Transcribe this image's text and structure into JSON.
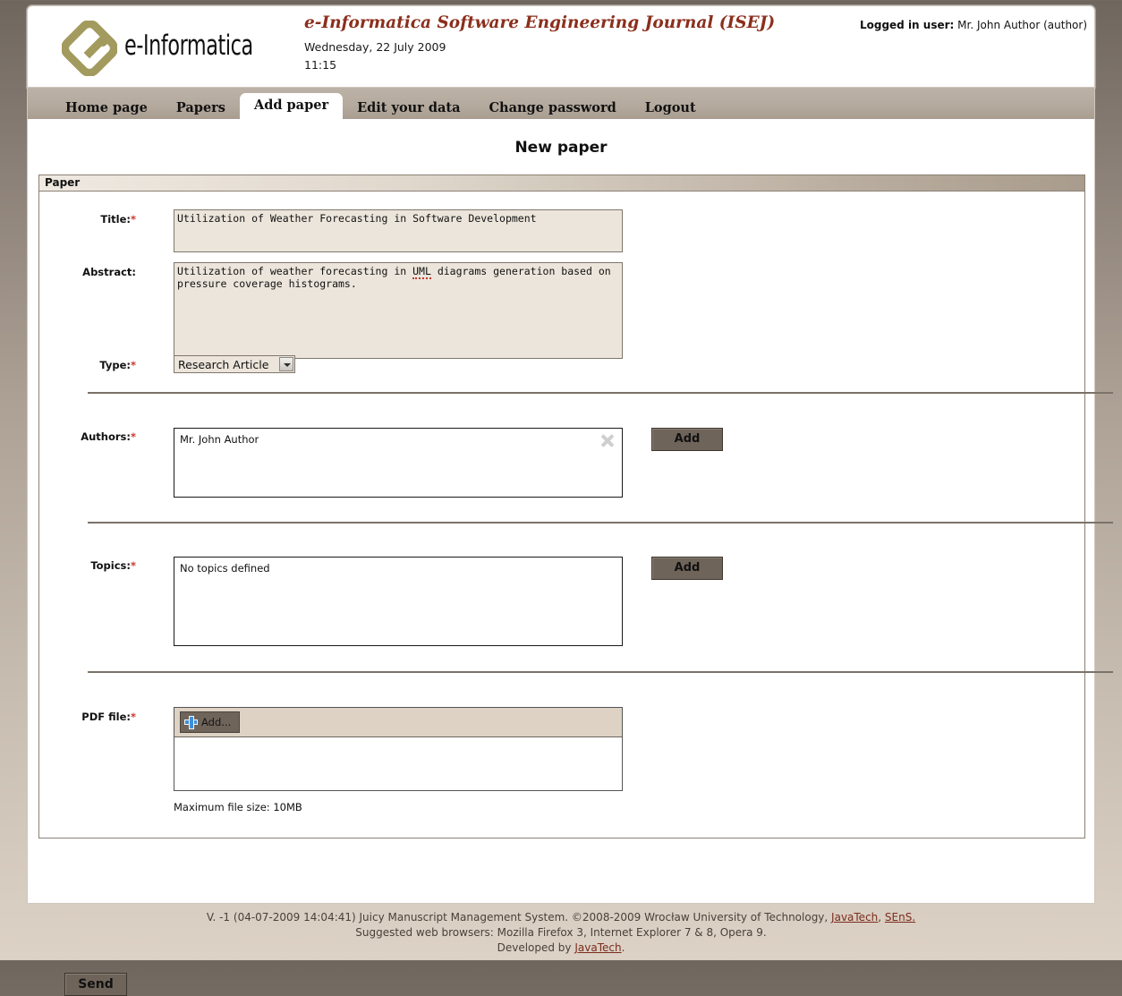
{
  "header": {
    "logo_text": "e-Informatica",
    "journal_title": "e-Informatica Software Engineering Journal (ISEJ)",
    "date": "Wednesday, 22 July 2009",
    "time": "11:15",
    "login_label": "Logged in user:",
    "login_user": "Mr. John Author (author)"
  },
  "tabs": [
    {
      "label": "Home page",
      "active": false
    },
    {
      "label": "Papers",
      "active": false
    },
    {
      "label": "Add paper",
      "active": true
    },
    {
      "label": "Edit your data",
      "active": false
    },
    {
      "label": "Change password",
      "active": false
    },
    {
      "label": "Logout",
      "active": false
    }
  ],
  "page": {
    "title": "New paper",
    "panel_legend": "Paper"
  },
  "form": {
    "title": {
      "label": "Title:",
      "required": "*",
      "value": "Utilization of Weather Forecasting in Software Development"
    },
    "abstract": {
      "label": "Abstract:",
      "required": "",
      "value_before": "Utilization of weather forecasting in ",
      "value_misspelled": "UML",
      "value_after": " diagrams generation based on\npressure coverage histograms."
    },
    "type": {
      "label": "Type:",
      "required": "*",
      "selected": "Research Article",
      "options": [
        "Research Article"
      ]
    },
    "authors": {
      "label": "Authors:",
      "required": "*",
      "entries": [
        "Mr. John Author"
      ],
      "add_label": "Add",
      "delete_icon": "close-x-icon"
    },
    "topics": {
      "label": "Topics:",
      "required": "*",
      "empty_text": "No topics defined",
      "add_label": "Add"
    },
    "pdf": {
      "label": "PDF file:",
      "required": "*",
      "add_label": "Add...",
      "add_icon": "plus-icon",
      "max_size_text": "Maximum file size: 10MB"
    },
    "submit_label": "Send"
  },
  "footer": {
    "line1_a": "V. -1 (04-07-2009 14:04:41) Juicy Manuscript Management System. ©2008-2009 Wrocław University of Technology, ",
    "line1_link1": "JavaTech",
    "line1_sep": ", ",
    "line1_link2": "SEnS.",
    "line2": "Suggested web browsers: Mozilla Firefox 3, Internet Explorer 7 & 8, Opera 9.",
    "line3_a": "Developed by ",
    "line3_link": "JavaTech",
    "line3_b": "."
  },
  "colors": {
    "accent": "#8b2f1d",
    "required": "#d0342c",
    "button": "#6f645a",
    "field_bg": "#ece5db",
    "link": "#7b2c1c"
  }
}
